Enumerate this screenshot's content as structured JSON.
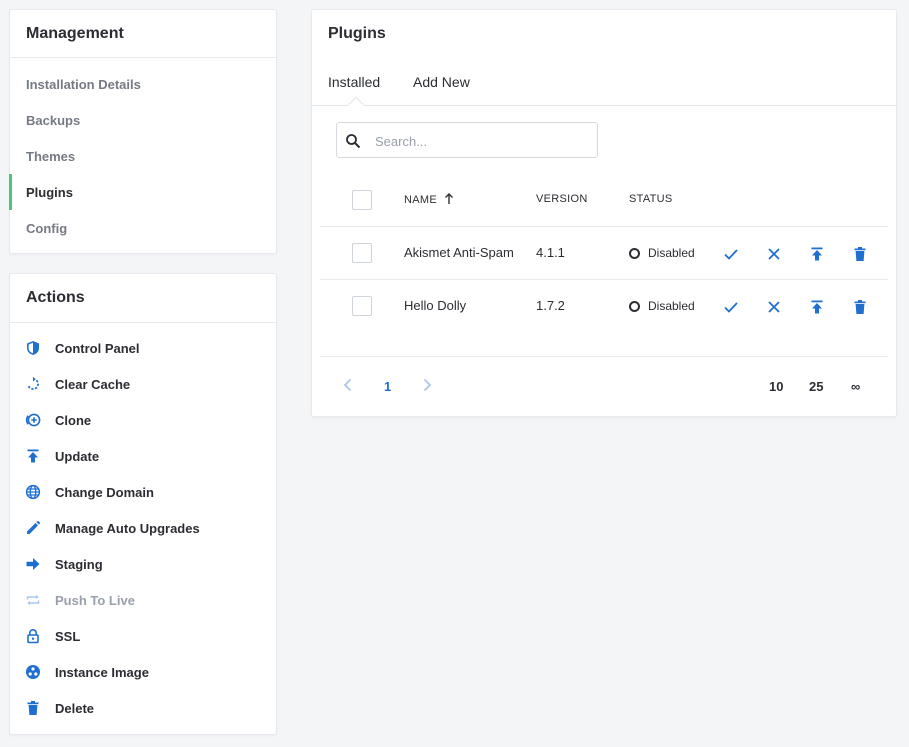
{
  "management": {
    "title": "Management",
    "items": [
      {
        "label": "Installation Details"
      },
      {
        "label": "Backups"
      },
      {
        "label": "Themes"
      },
      {
        "label": "Plugins"
      },
      {
        "label": "Config"
      }
    ],
    "active_item": "Plugins"
  },
  "actions": {
    "title": "Actions",
    "items": [
      {
        "label": "Control Panel",
        "icon": "shield-icon"
      },
      {
        "label": "Clear Cache",
        "icon": "refresh-icon"
      },
      {
        "label": "Clone",
        "icon": "clone-icon"
      },
      {
        "label": "Update",
        "icon": "upload-icon"
      },
      {
        "label": "Change Domain",
        "icon": "globe-icon"
      },
      {
        "label": "Manage Auto Upgrades",
        "icon": "pencil-icon"
      },
      {
        "label": "Staging",
        "icon": "arrow-right-icon"
      },
      {
        "label": "Push To Live",
        "icon": "repeat-icon",
        "disabled": true
      },
      {
        "label": "SSL",
        "icon": "lock-icon"
      },
      {
        "label": "Instance Image",
        "icon": "instance-image-icon"
      },
      {
        "label": "Delete",
        "icon": "trash-icon"
      }
    ]
  },
  "plugins": {
    "title": "Plugins",
    "tabs": [
      {
        "label": "Installed"
      },
      {
        "label": "Add New"
      }
    ],
    "active_tab": "Installed",
    "search": {
      "placeholder": "Search...",
      "value": ""
    },
    "columns": {
      "name": "NAME",
      "version": "VERSION",
      "status": "STATUS"
    },
    "rows": [
      {
        "name": "Akismet Anti-Spam",
        "version": "4.1.1",
        "status": "Disabled"
      },
      {
        "name": "Hello Dolly",
        "version": "1.7.2",
        "status": "Disabled"
      }
    ],
    "pagination": {
      "current_page": "1",
      "per_page_options": [
        "10",
        "25",
        "∞"
      ]
    }
  },
  "colors": {
    "accent": "#1f6fd1",
    "active_indicator": "#4cc47a",
    "disabled_text": "#9aa0ab"
  }
}
